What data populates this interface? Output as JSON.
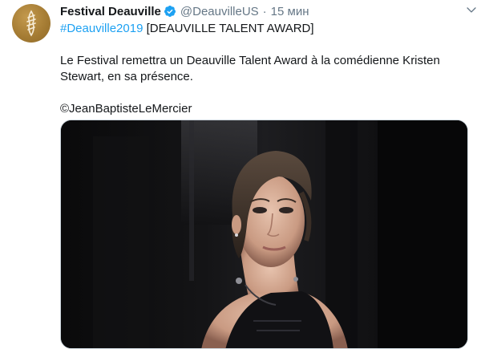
{
  "tweet": {
    "display_name": "Festival Deauville",
    "handle": "@DeauvilleUS",
    "separator": "·",
    "time": "15 мин",
    "hashtag": "#Deauville2019",
    "headline_rest": " [DEAUVILLE TALENT AWARD]",
    "body": "Le Festival remettra un Deauville Talent Award à la comédienne Kristen Stewart, en sa présence.",
    "credit": "©JeanBaptisteLeMercier"
  },
  "icons": {
    "avatar": "festival-logo-avatar",
    "verified": "verified-badge-icon",
    "menu": "chevron-down-icon"
  },
  "colors": {
    "link": "#1da1f2",
    "secondary_text": "#657786",
    "avatar_gold": "#a37a32",
    "verified_blue": "#1da1f2"
  }
}
